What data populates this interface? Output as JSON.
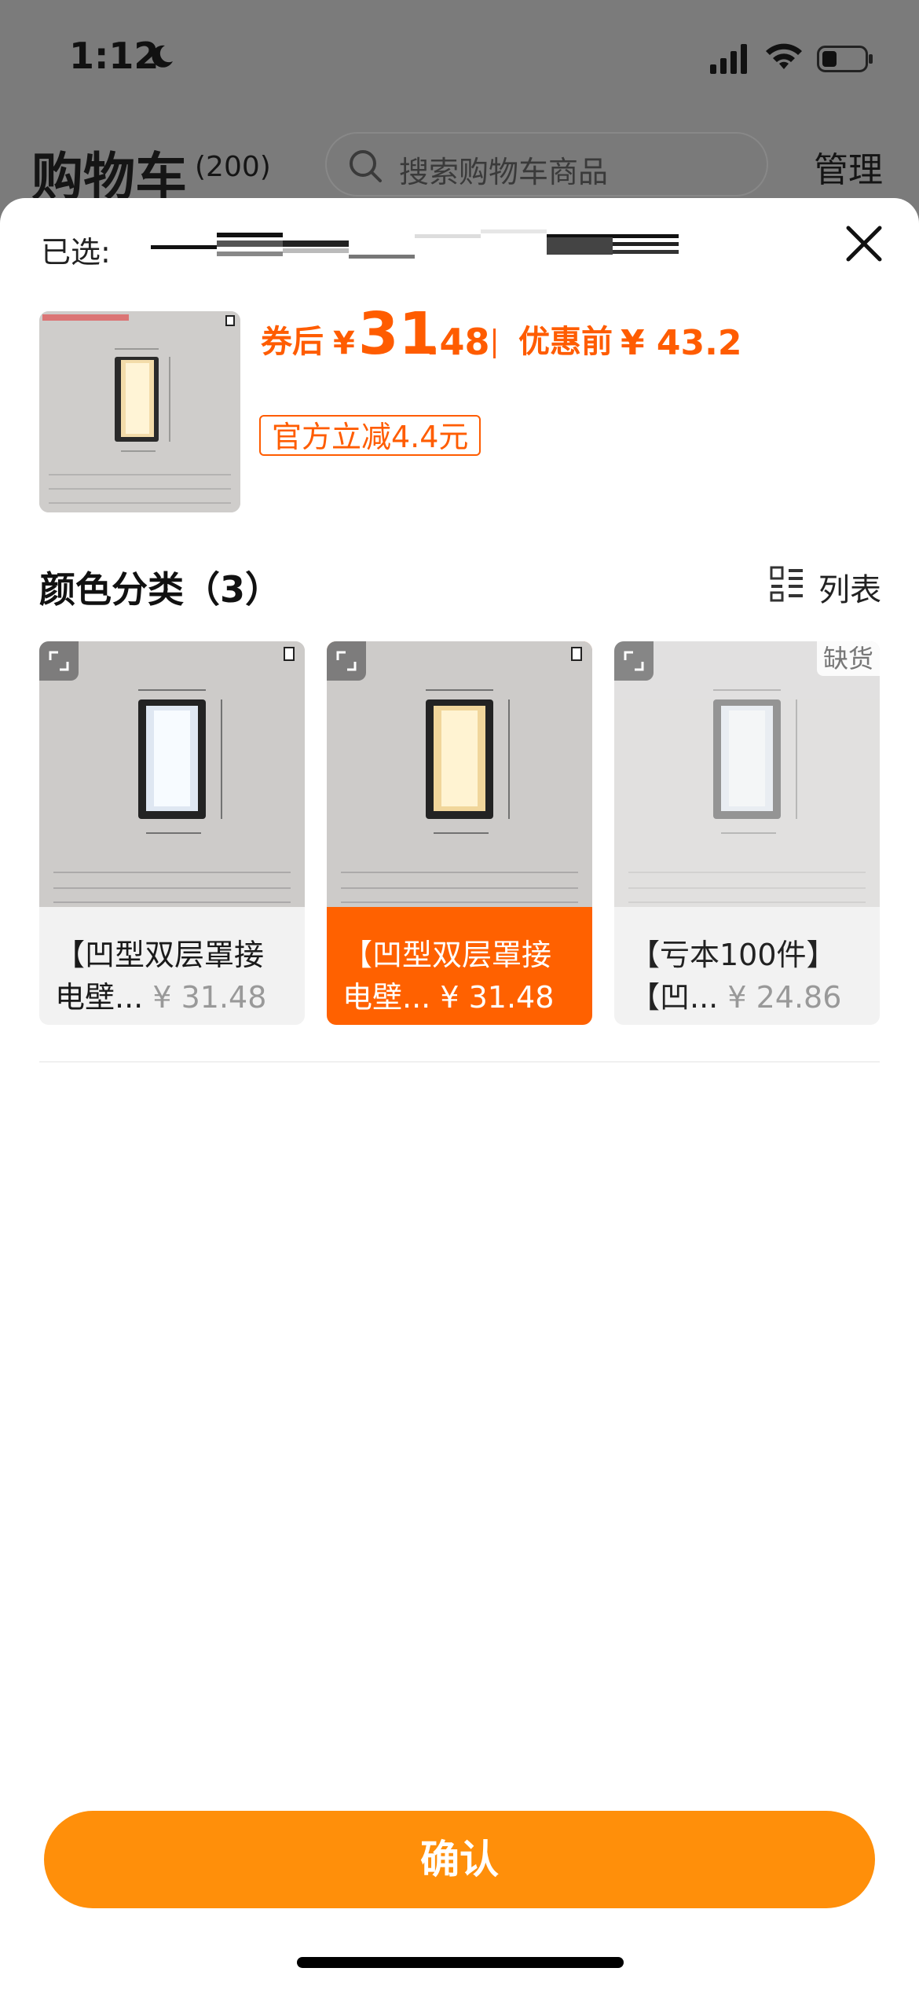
{
  "status_bar": {
    "time": "1:12"
  },
  "cart_header": {
    "title": "购物车",
    "count": "(200)",
    "search_placeholder": "搜索购物车商品",
    "manage_label": "管理"
  },
  "sheet": {
    "selected_label": "已选:",
    "price": {
      "after_label": "券后",
      "currency": "¥",
      "after_int": "31",
      "after_dec": ".48",
      "before_label": "优惠前",
      "before_value": "¥ 43.2"
    },
    "promo_tag": "官方立减4.4元",
    "section_title": "颜色分类（3）",
    "list_toggle_label": "列表",
    "options": [
      {
        "line1": "【凹型双层罩接",
        "line2": "电壁...",
        "price": "¥ 31.48",
        "state": "normal",
        "light": "white"
      },
      {
        "line1": "【凹型双层罩接",
        "line2": "电壁...",
        "price": "¥ 31.48",
        "state": "selected",
        "light": "warm"
      },
      {
        "line1": "【亏本100件】",
        "line2": "【凹...",
        "price": "¥ 24.86",
        "state": "out_of_stock",
        "light": "white",
        "badge": "缺货"
      }
    ],
    "confirm_label": "确认"
  },
  "colors": {
    "accent_orange": "#ff5c00",
    "selected_bg": "#ff6100",
    "confirm_bg": "#ff8f0a"
  }
}
